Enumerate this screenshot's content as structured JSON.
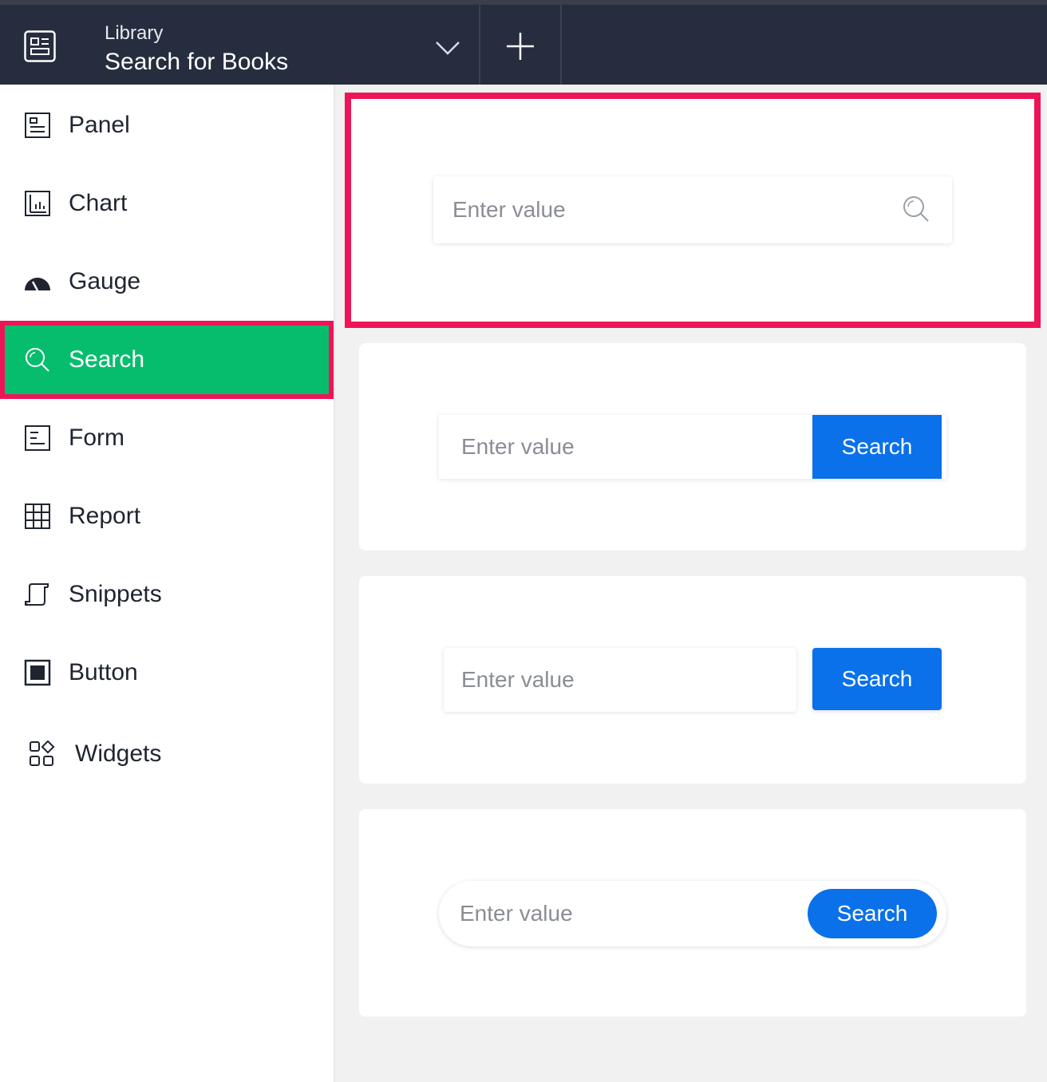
{
  "header": {
    "breadcrumb": "Library",
    "title": "Search for Books"
  },
  "sidebar": {
    "items": [
      {
        "label": "Panel"
      },
      {
        "label": "Chart"
      },
      {
        "label": "Gauge"
      },
      {
        "label": "Search"
      },
      {
        "label": "Form"
      },
      {
        "label": "Report"
      },
      {
        "label": "Snippets"
      },
      {
        "label": "Button"
      },
      {
        "label": "Widgets"
      }
    ],
    "active": "Search"
  },
  "variants": [
    {
      "placeholder": "Enter value",
      "icon": "search-icon"
    },
    {
      "placeholder": "Enter value",
      "button": "Search"
    },
    {
      "placeholder": "Enter value",
      "button": "Search"
    },
    {
      "placeholder": "Enter value",
      "button": "Search"
    }
  ],
  "colors": {
    "topbar": "#262d3f",
    "active_nav": "#06bd6e",
    "highlight": "#ee1557",
    "button": "#0a71ea"
  }
}
